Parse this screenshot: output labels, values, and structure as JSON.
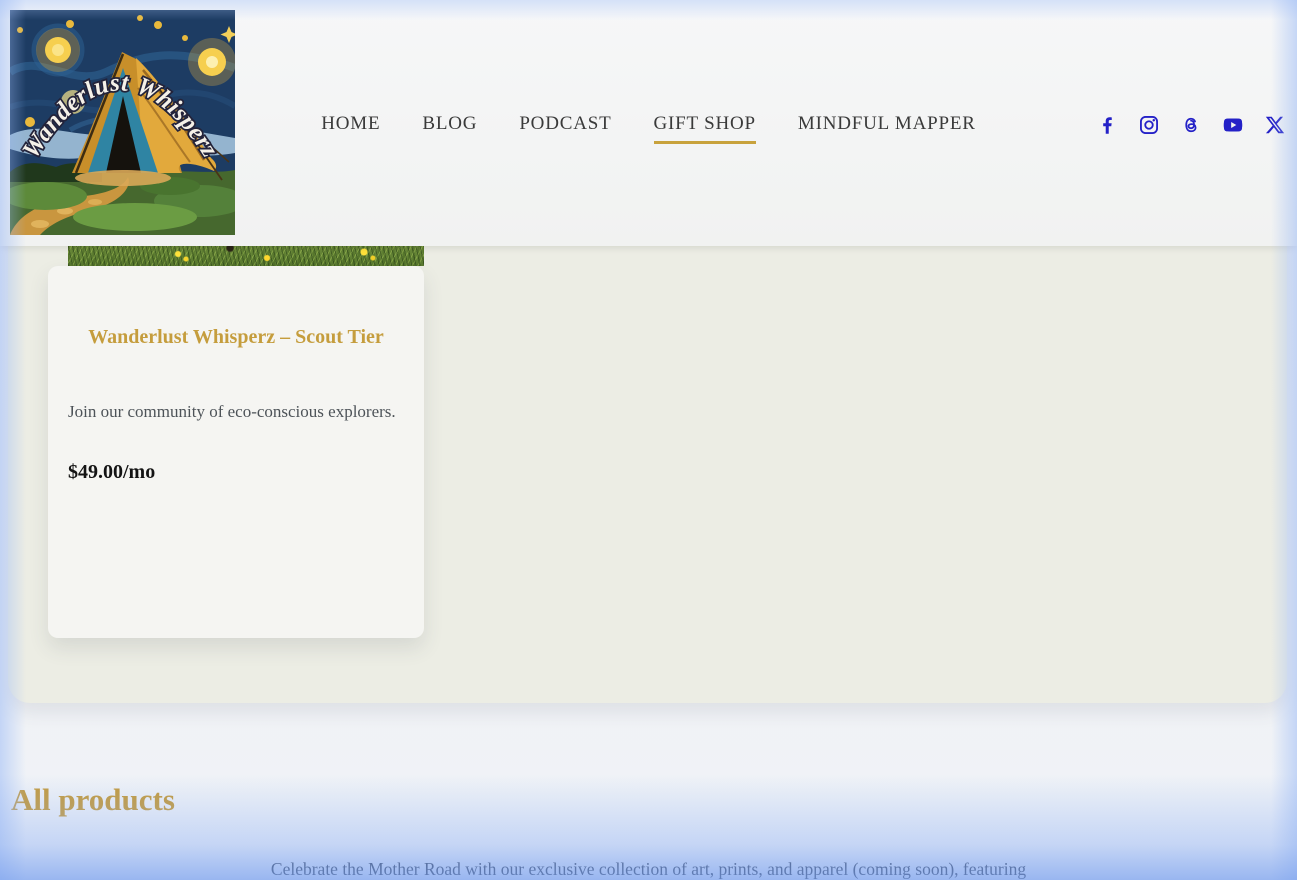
{
  "brand": {
    "logo_text": "Wanderlust Whisperz"
  },
  "header": {
    "nav": [
      {
        "label": "HOME",
        "active": false
      },
      {
        "label": "BLOG",
        "active": false
      },
      {
        "label": "PODCAST",
        "active": false
      },
      {
        "label": "GIFT SHOP",
        "active": true
      },
      {
        "label": "MINDFUL MAPPER",
        "active": false
      }
    ],
    "social": [
      {
        "name": "facebook"
      },
      {
        "name": "instagram"
      },
      {
        "name": "threads"
      },
      {
        "name": "youtube"
      },
      {
        "name": "x"
      }
    ]
  },
  "membership": {
    "card": {
      "title": "Wanderlust Whisperz – Scout Tier",
      "description": "Join our community of eco-conscious explorers.",
      "price": "$49.00/mo"
    }
  },
  "products": {
    "heading": "All products",
    "intro": "Celebrate the Mother Road with our exclusive collection of art, prints, and apparel (coming soon), featuring"
  },
  "colors": {
    "accent_gold": "#c8a23c",
    "title_gold": "#c59d3d",
    "icon_blue": "#2421c7",
    "nav_text": "#3a3a3a",
    "section_bg": "#ecede4",
    "card_bg": "#f5f5f2"
  }
}
